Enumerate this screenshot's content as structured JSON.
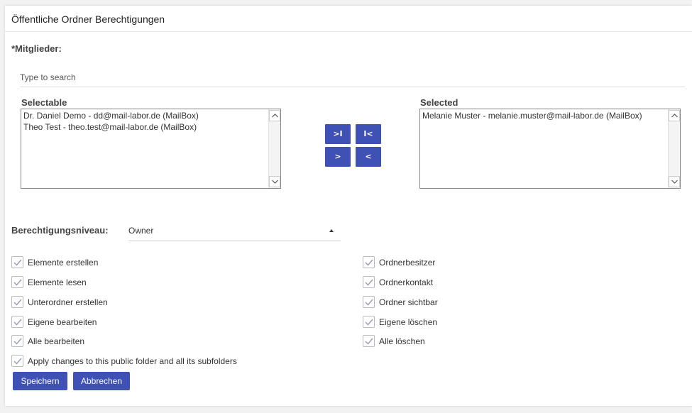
{
  "header": {
    "title": "Öffentliche Ordner Berechtigungen"
  },
  "members": {
    "label": "*Mitglieder:",
    "search_placeholder": "Type to search",
    "selectable_label": "Selectable",
    "selected_label": "Selected",
    "selectable_items": [
      "Dr. Daniel Demo - dd@mail-labor.de (MailBox)",
      "Theo Test - theo.test@mail-labor.de (MailBox)"
    ],
    "selected_items": [
      "Melanie Muster - melanie.muster@mail-labor.de (MailBox)"
    ],
    "buttons": {
      "move_all_right": ">I",
      "move_all_left": "I<",
      "move_right": ">",
      "move_left": "<"
    }
  },
  "permission": {
    "label": "Berechtigungsniveau:",
    "value": "Owner"
  },
  "checkboxes_left": [
    {
      "label": "Elemente erstellen",
      "checked": true
    },
    {
      "label": "Elemente lesen",
      "checked": true
    },
    {
      "label": "Unterordner erstellen",
      "checked": true
    },
    {
      "label": "Eigene bearbeiten",
      "checked": true
    },
    {
      "label": "Alle bearbeiten",
      "checked": true
    }
  ],
  "checkboxes_right": [
    {
      "label": "Ordnerbesitzer",
      "checked": true
    },
    {
      "label": "Ordnerkontakt",
      "checked": true
    },
    {
      "label": "Ordner sichtbar",
      "checked": true
    },
    {
      "label": "Eigene löschen",
      "checked": true
    },
    {
      "label": "Alle löschen",
      "checked": true
    }
  ],
  "apply_all": {
    "label": "Apply changes to this public folder and all its subfolders",
    "checked": true
  },
  "actions": {
    "save": "Speichern",
    "cancel": "Abbrechen"
  },
  "colors": {
    "primary": "#3f51b5",
    "check": "#9aa0b8"
  }
}
